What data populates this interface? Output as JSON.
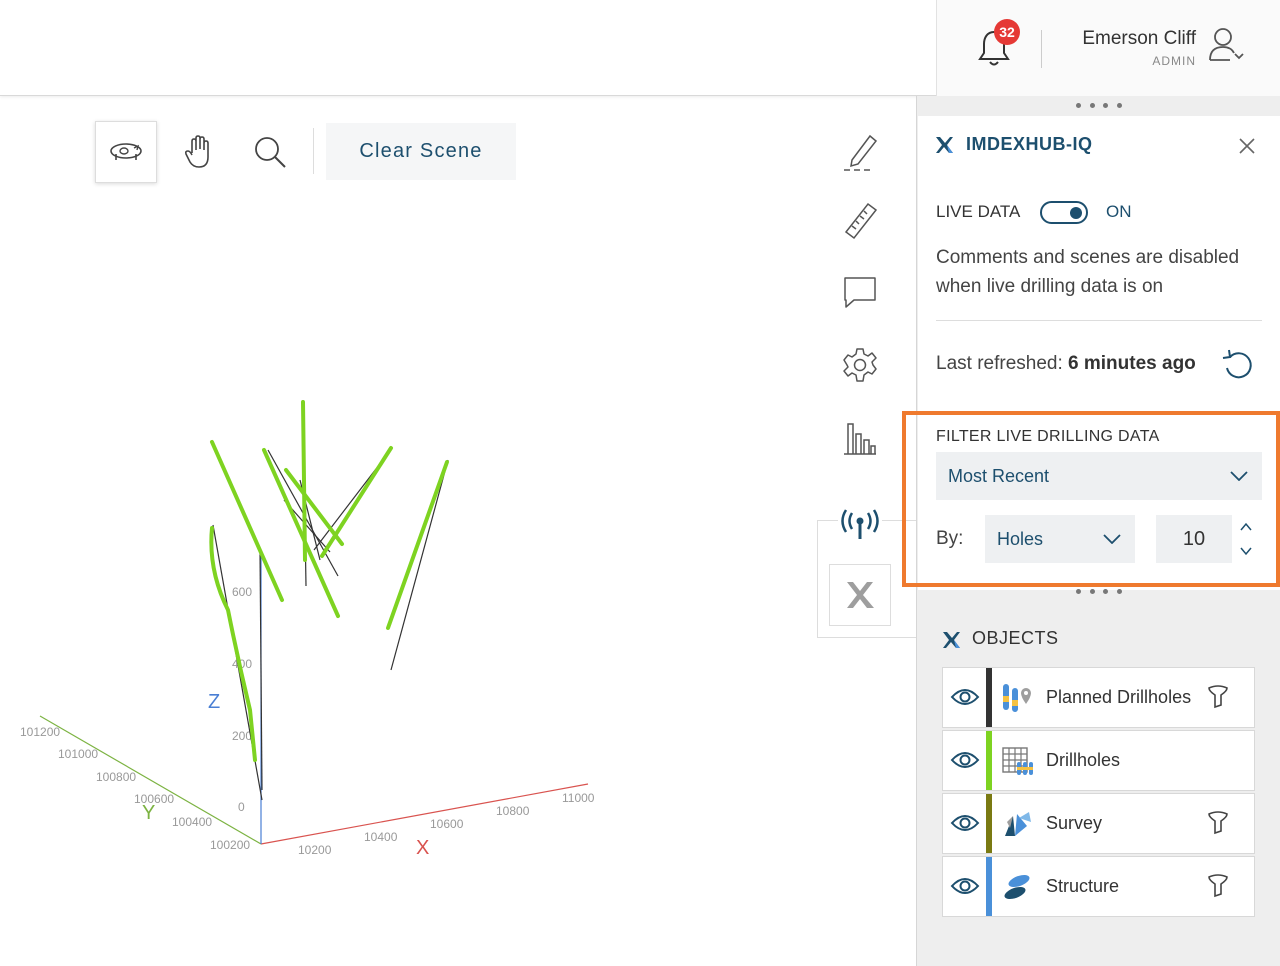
{
  "header": {
    "notification_count": "32",
    "user_name": "Emerson Cliff",
    "user_role": "ADMIN"
  },
  "toolbar": {
    "clear_scene_label": "Clear Scene"
  },
  "scene": {
    "axis_x_label": "X",
    "axis_y_label": "Y",
    "axis_z_label": "Z",
    "x_ticks": [
      "10200",
      "10400",
      "10600",
      "10800",
      "11000"
    ],
    "y_ticks": [
      "101200",
      "101000",
      "100800",
      "100600",
      "100400",
      "100200"
    ],
    "z_ticks": [
      "600",
      "400",
      "200",
      "0"
    ],
    "colors": {
      "x_axis": "#d9534f",
      "y_axis": "#7cb342",
      "z_axis": "#4a7fd4",
      "drillhole": "#7ed321"
    }
  },
  "panel": {
    "title": "IMDEXHUB-IQ",
    "live_data_label": "LIVE DATA",
    "live_data_state": "ON",
    "notice": "Comments and scenes are disabled when live drilling data is on",
    "last_refreshed_label": "Last refreshed: ",
    "last_refreshed_value": "6 minutes ago",
    "filter_label": "FILTER LIVE DRILLING DATA",
    "filter_selected": "Most Recent",
    "by_label": "By:",
    "by_selected": "Holes",
    "count_value": "10",
    "objects_title": "OBJECTS",
    "objects": [
      {
        "label": "Planned Drillholes",
        "color": "#333333"
      },
      {
        "label": "Drillholes",
        "color": "#7ed321"
      },
      {
        "label": "Survey",
        "color": "#7a7a12"
      },
      {
        "label": "Structure",
        "color": "#4a90d9"
      }
    ],
    "accent_color": "#1d4f6e",
    "highlight_color": "#ef7a2e"
  }
}
